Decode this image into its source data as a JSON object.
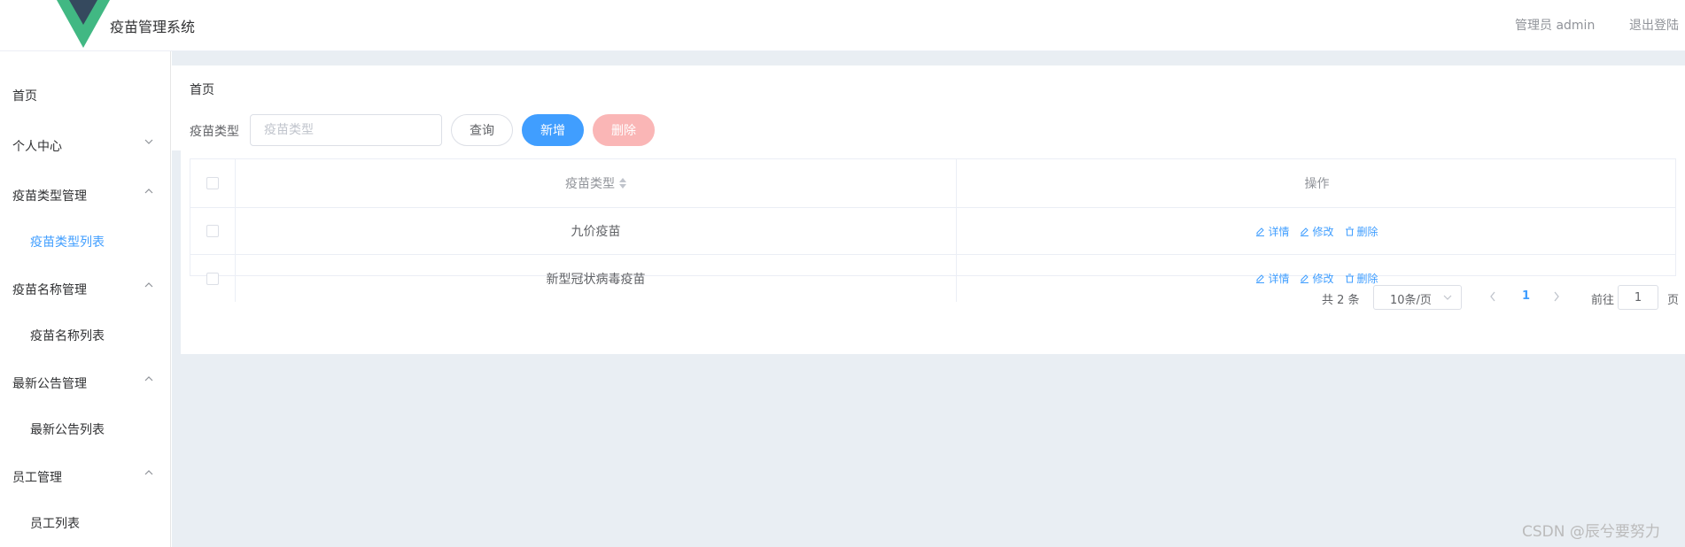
{
  "header": {
    "app_title": "疫苗管理系统",
    "user": "管理员 admin",
    "logout": "退出登陆",
    "logo_colors": {
      "outer": "#41b883",
      "inner": "#35495e"
    }
  },
  "sidebar": {
    "home": "首页",
    "groups": [
      {
        "label": "个人中心",
        "expanded": false
      },
      {
        "label": "疫苗类型管理",
        "expanded": true,
        "sub": "疫苗类型列表"
      },
      {
        "label": "疫苗名称管理",
        "expanded": true,
        "sub": "疫苗名称列表"
      },
      {
        "label": "最新公告管理",
        "expanded": true,
        "sub": "最新公告列表"
      },
      {
        "label": "员工管理",
        "expanded": true,
        "sub": "员工列表"
      }
    ],
    "active_sub": "疫苗类型列表"
  },
  "breadcrumb": "首页",
  "search": {
    "label": "疫苗类型",
    "placeholder": "疫苗类型",
    "value": ""
  },
  "buttons": {
    "query": "查询",
    "add": "新增",
    "delete": "删除"
  },
  "table": {
    "headers": {
      "type": "疫苗类型",
      "operation": "操作"
    },
    "rows": [
      {
        "type": "九价疫苗"
      },
      {
        "type": "新型冠状病毒疫苗"
      }
    ],
    "row_actions": {
      "detail": "详情",
      "edit": "修改",
      "delete": "删除"
    }
  },
  "pagination": {
    "total": "共 2 条",
    "page_size": "10条/页",
    "current_page": "1",
    "goto_label": "前往",
    "goto_value": "1",
    "page_suffix": "页"
  },
  "watermark": "CSDN @辰兮要努力",
  "colors": {
    "primary": "#409eff",
    "danger_disabled": "#fab6b6",
    "background": "#e9eef3"
  }
}
